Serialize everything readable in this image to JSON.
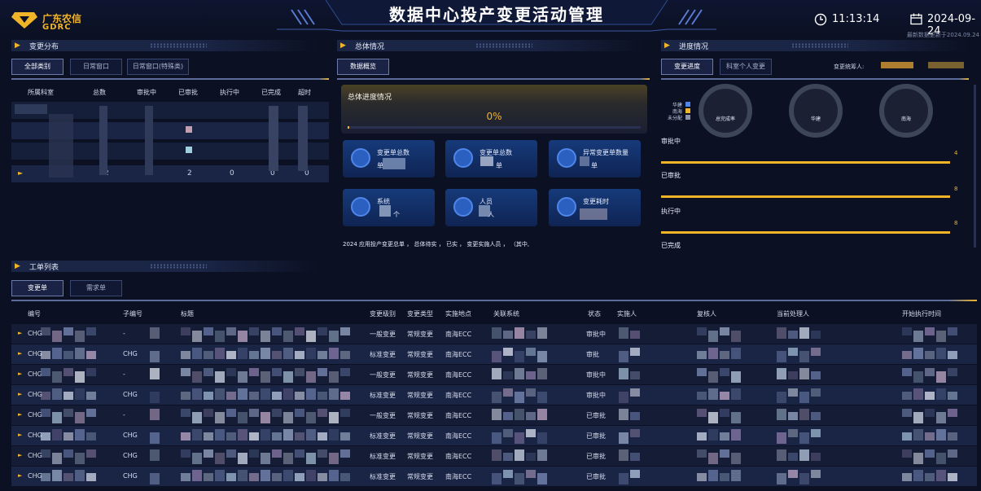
{
  "header": {
    "logo_cn": "广东农信",
    "logo_en": "GDRC",
    "title": "数据中心投产变更活动管理",
    "time": "11:13:14",
    "date": "2024-09-24",
    "updated": "最新数据更新于2024.09.24"
  },
  "left_panel": {
    "title": "变更分布",
    "tabs": [
      "全部类别",
      "日常窗口",
      "日常窗口(特殊类)"
    ],
    "columns": [
      "所属科室",
      "总数",
      "审批中",
      "已审批",
      "执行中",
      "已完成",
      "超时"
    ],
    "last_row_values": [
      "2",
      "2",
      "0",
      "0",
      "0"
    ]
  },
  "center_panel": {
    "title": "总体情况",
    "tab": "数据概览",
    "overall_title": "总体进度情况",
    "overall_pct": "0%",
    "cards": [
      {
        "label": "变更单总数",
        "unit": "单"
      },
      {
        "label": "变更单总数",
        "unit": "单"
      },
      {
        "label": "异常变更单数量",
        "unit": "单"
      },
      {
        "label": "系统",
        "unit": "个"
      },
      {
        "label": "人员",
        "unit": "人"
      },
      {
        "label": "变更耗时",
        "unit": ""
      }
    ],
    "summary": "2024 应用投产变更总单 ， 总体待实 ， 已实 ， 变更实施人员 ， （其中,"
  },
  "right_panel": {
    "title": "进度情况",
    "tabs": [
      "变更进度",
      "科室个人变更"
    ],
    "implementer_label": "变更统筹人:",
    "legend": [
      {
        "label": "华建",
        "color": "#4f86e8"
      },
      {
        "label": "南海",
        "color": "#f0b429"
      },
      {
        "label": "未分配",
        "color": "#8a93a8"
      }
    ],
    "donuts": [
      "总完成率",
      "华建",
      "南海"
    ],
    "progress": [
      {
        "label": "审批中",
        "value": "4",
        "pct": 1.0
      },
      {
        "label": "已审批",
        "value": "8",
        "pct": 1.0
      },
      {
        "label": "执行中",
        "value": "8",
        "pct": 1.0
      },
      {
        "label": "已完成",
        "value": "",
        "pct": 1.0
      }
    ]
  },
  "worklist": {
    "title": "工单列表",
    "tabs": [
      "变更单",
      "需求单"
    ],
    "columns": [
      "编号",
      "子编号",
      "标题",
      "变更级别",
      "变更类型",
      "实施地点",
      "关联系统",
      "状态",
      "实施人",
      "复核人",
      "当前处理人",
      "开始执行时间"
    ],
    "rows": [
      {
        "id": "CHG",
        "sub": "-",
        "level": "一般变更",
        "type": "常规变更",
        "loc": "南海ECC",
        "status": "审批中"
      },
      {
        "id": "CHG",
        "sub": "CHG",
        "level": "标准变更",
        "type": "常规变更",
        "loc": "南海ECC",
        "status": "审批"
      },
      {
        "id": "CHG",
        "sub": "-",
        "level": "一般变更",
        "type": "常规变更",
        "loc": "南海ECC",
        "status": "审批中"
      },
      {
        "id": "CHG",
        "sub": "CHG",
        "level": "标准变更",
        "type": "常规变更",
        "loc": "南海ECC",
        "status": "审批中"
      },
      {
        "id": "CHG",
        "sub": "-",
        "level": "一般变更",
        "type": "常规变更",
        "loc": "南海ECC",
        "status": "已审批"
      },
      {
        "id": "CHG",
        "sub": "CHG",
        "level": "标准变更",
        "type": "常规变更",
        "loc": "南海ECC",
        "status": "已审批"
      },
      {
        "id": "CHG",
        "sub": "CHG",
        "level": "标准变更",
        "type": "常规变更",
        "loc": "南海ECC",
        "status": "已审批"
      },
      {
        "id": "CHG",
        "sub": "CHG",
        "level": "标准变更",
        "type": "常规变更",
        "loc": "南海ECC",
        "status": "已审批"
      }
    ]
  },
  "colors": {
    "accent": "#f0b429",
    "background": "#0b1022",
    "card_blue": "#163a7a"
  }
}
